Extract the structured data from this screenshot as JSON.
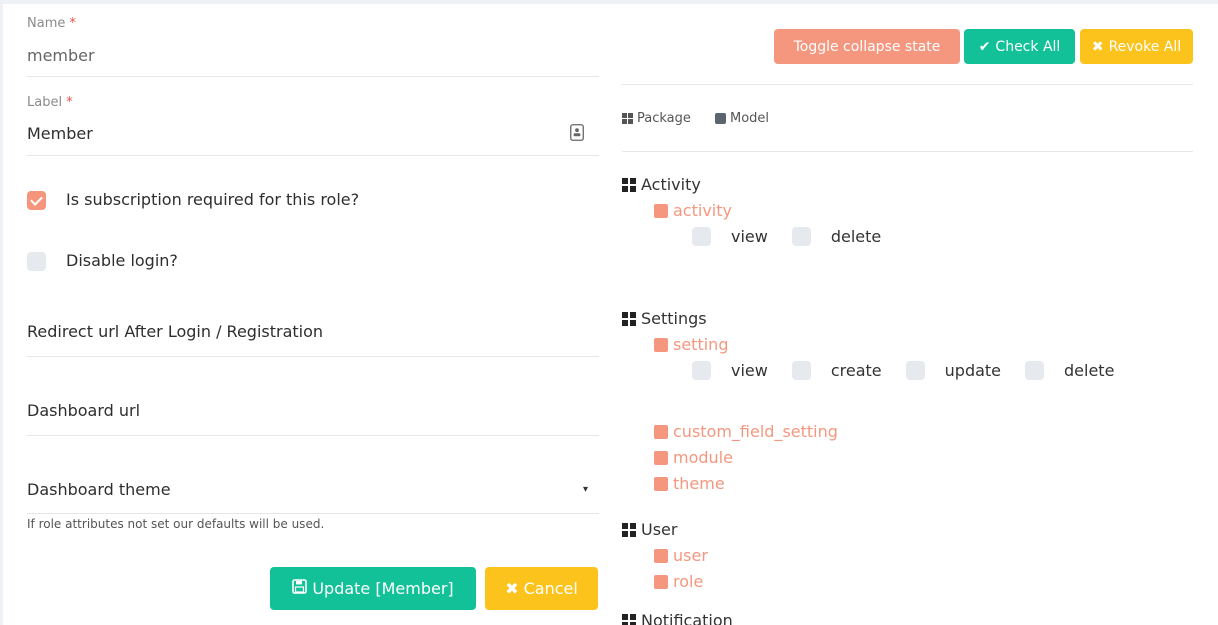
{
  "form": {
    "name": {
      "label": "Name",
      "required_mark": "*",
      "value": "member"
    },
    "role_label": {
      "label": "Label",
      "required_mark": "*",
      "value": "Member",
      "icon": "contact-card-icon"
    },
    "subscription": {
      "label": "Is subscription required for this role?",
      "checked": true
    },
    "disable_login": {
      "label": "Disable login?",
      "checked": false
    },
    "redirect_url": {
      "placeholder": "Redirect url After Login / Registration"
    },
    "dashboard_url": {
      "placeholder": "Dashboard url"
    },
    "dashboard_theme": {
      "placeholder": "Dashboard theme",
      "caret": "▾"
    },
    "hint": "If role attributes not set our defaults will be used.",
    "update_button": "Update [Member]",
    "cancel_button": "Cancel"
  },
  "toolbar": {
    "toggle": "Toggle collapse state",
    "check_all": "Check All",
    "revoke_all": "Revoke All"
  },
  "legend": {
    "package": "Package",
    "model": "Model"
  },
  "tree": {
    "activity": {
      "name": "Activity",
      "models": {
        "activity": "activity"
      },
      "perms": [
        "view",
        "delete"
      ]
    },
    "settings": {
      "name": "Settings",
      "models": {
        "setting": "setting",
        "custom_field_setting": "custom_field_setting",
        "module": "module",
        "theme": "theme"
      },
      "perms": [
        "view",
        "create",
        "update",
        "delete"
      ]
    },
    "user": {
      "name": "User",
      "models": {
        "user": "user",
        "role": "role"
      }
    },
    "notification": {
      "name": "Notification"
    }
  },
  "colors": {
    "accent": "#f5977f",
    "green": "#13c198",
    "yellow": "#fcc31c"
  }
}
